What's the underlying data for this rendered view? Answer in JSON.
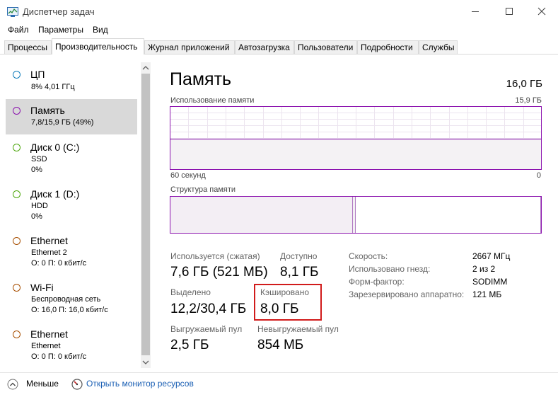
{
  "window": {
    "title": "Диспетчер задач",
    "icons": {
      "app": "task-manager-icon",
      "minimize": "minimize-icon",
      "maximize": "maximize-icon",
      "close": "close-icon"
    }
  },
  "menu": [
    "Файл",
    "Параметры",
    "Вид"
  ],
  "tabs": [
    {
      "label": "Процессы",
      "active": false
    },
    {
      "label": "Производительность",
      "active": true
    },
    {
      "label": "Журнал приложений",
      "active": false
    },
    {
      "label": "Автозагрузка",
      "active": false
    },
    {
      "label": "Пользователи",
      "active": false
    },
    {
      "label": "Подробности",
      "active": false
    },
    {
      "label": "Службы",
      "active": false
    }
  ],
  "sidebar": {
    "items": [
      {
        "title": "ЦП",
        "line1": "8% 4,01 ГГц",
        "line2": "",
        "color": "#117dbb",
        "selected": false
      },
      {
        "title": "Память",
        "line1": "7,8/15,9 ГБ (49%)",
        "line2": "",
        "color": "#8b12ae",
        "selected": true
      },
      {
        "title": "Диск 0 (C:)",
        "line1": "SSD",
        "line2": "0%",
        "color": "#4da60c",
        "selected": false
      },
      {
        "title": "Диск 1 (D:)",
        "line1": "HDD",
        "line2": "0%",
        "color": "#4da60c",
        "selected": false
      },
      {
        "title": "Ethernet",
        "line1": "Ethernet 2",
        "line2": "О: 0 П: 0 кбит/с",
        "color": "#a74f01",
        "selected": false
      },
      {
        "title": "Wi-Fi",
        "line1": "Беспроводная сеть",
        "line2": "О: 16,0 П: 16,0 кбит/с",
        "color": "#a74f01",
        "selected": false
      },
      {
        "title": "Ethernet",
        "line1": "Ethernet",
        "line2": "О: 0 П: 0 кбит/с",
        "color": "#a74f01",
        "selected": false
      }
    ],
    "scroll_up_icon": "scroll-up-arrow-icon",
    "scroll_down_icon": "scroll-down-arrow-icon"
  },
  "main": {
    "title": "Память",
    "total": "16,0 ГБ",
    "usage_graph": {
      "label": "Использование памяти",
      "max": "15,9 ГБ",
      "x_left": "60 секунд",
      "x_right": "0",
      "fill_fraction": 0.49,
      "line_color": "#8b12ae",
      "fill_color": "#f4f2f4"
    },
    "composition": {
      "label": "Структура памяти",
      "in_use_fraction": 0.49,
      "modified_fraction": 0.005,
      "standby_fraction": 0.5
    },
    "stats": {
      "in_use_label": "Используется (сжатая)",
      "in_use_value": "7,6 ГБ (521 МБ)",
      "available_label": "Доступно",
      "available_value": "8,1 ГБ",
      "committed_label": "Выделено",
      "committed_value": "12,2/30,4 ГБ",
      "cached_label": "Кэшировано",
      "cached_value": "8,0 ГБ",
      "paged_label": "Выгружаемый пул",
      "paged_value": "2,5 ГБ",
      "nonpaged_label": "Невыгружаемый пул",
      "nonpaged_value": "854 МБ"
    },
    "details": [
      {
        "label": "Скорость:",
        "value": "2667 МГц"
      },
      {
        "label": "Использовано гнезд:",
        "value": "2 из 2"
      },
      {
        "label": "Форм-фактор:",
        "value": "SODIMM"
      },
      {
        "label": "Зарезервировано аппаратно:",
        "value": "121 МБ"
      }
    ],
    "highlight_color": "#d11b1b"
  },
  "footer": {
    "less_label": "Меньше",
    "less_icon": "chevron-up-icon",
    "monitor_label": "Открыть монитор ресурсов",
    "monitor_icon": "resource-monitor-icon"
  }
}
